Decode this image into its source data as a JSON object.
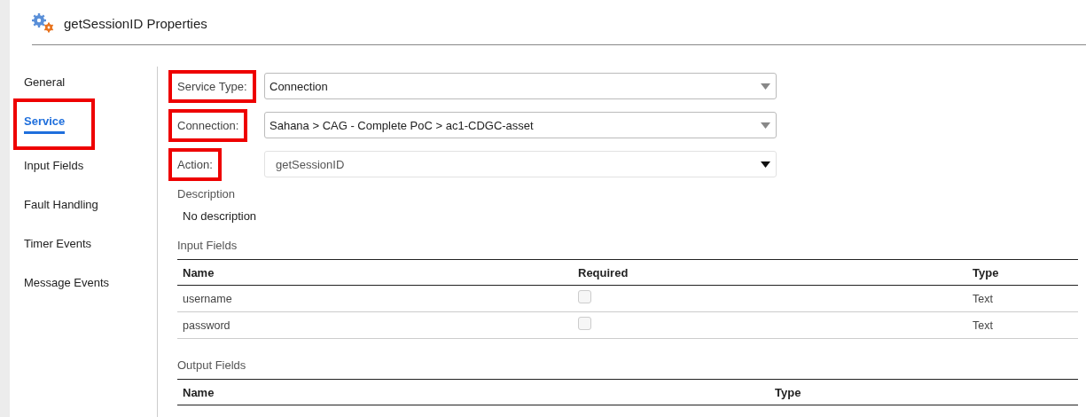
{
  "header": {
    "title": "getSessionID Properties"
  },
  "sidebar": {
    "items": [
      {
        "label": "General",
        "selected": false,
        "highlighted": false
      },
      {
        "label": "Service",
        "selected": true,
        "highlighted": true
      },
      {
        "label": "Input Fields",
        "selected": false,
        "highlighted": false
      },
      {
        "label": "Fault Handling",
        "selected": false,
        "highlighted": false
      },
      {
        "label": "Timer Events",
        "selected": false,
        "highlighted": false
      },
      {
        "label": "Message Events",
        "selected": false,
        "highlighted": false
      }
    ]
  },
  "form": [
    {
      "label": "Service Type:",
      "value": "Connection",
      "disabled": false,
      "highlighted": true
    },
    {
      "label": "Connection:",
      "value": "Sahana > CAG - Complete PoC > ac1-CDGC-asset",
      "disabled": false,
      "highlighted": true
    },
    {
      "label": "Action:",
      "value": "getSessionID",
      "disabled": true,
      "highlighted": true
    }
  ],
  "description": {
    "heading": "Description",
    "text": "No description"
  },
  "input_fields": {
    "heading": "Input Fields",
    "columns": [
      "Name",
      "Required",
      "Type"
    ],
    "rows": [
      {
        "name": "username",
        "required": false,
        "type": "Text"
      },
      {
        "name": "password",
        "required": false,
        "type": "Text"
      }
    ]
  },
  "output_fields": {
    "heading": "Output Fields",
    "columns": [
      "Name",
      "Type"
    ]
  }
}
